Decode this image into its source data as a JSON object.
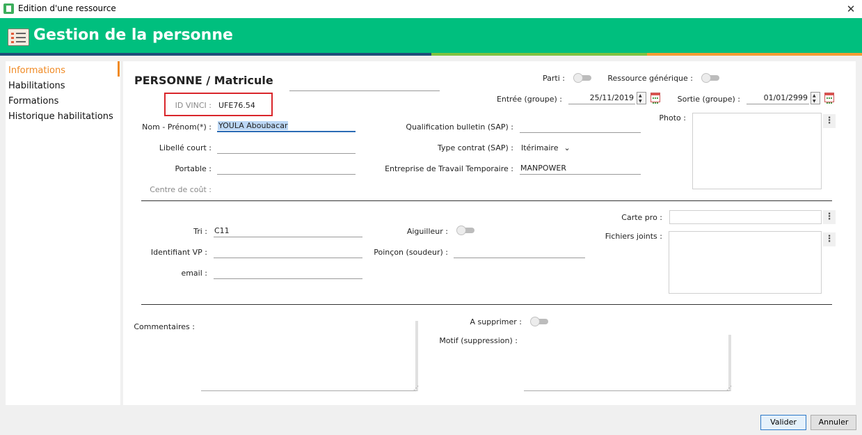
{
  "window": {
    "title": "Edition d'une ressource",
    "close_glyph": "✕"
  },
  "header": {
    "title": "Gestion de la personne",
    "icon": "list-icon",
    "stripe_colors": [
      "#1f4e79",
      "#7fc241",
      "#f39c34"
    ]
  },
  "nav": {
    "items": [
      {
        "label": "Informations",
        "active": true
      },
      {
        "label": "Habilitations",
        "active": false
      },
      {
        "label": "Formations",
        "active": false
      },
      {
        "label": "Historique habilitations",
        "active": false
      }
    ],
    "active_color": "#f08a24"
  },
  "form": {
    "section_title": "PERSONNE / Matricule",
    "id_vinci": {
      "label": "ID VINCI :",
      "value": "UFE76.54",
      "highlight_color": "#d9262b"
    },
    "nom_prenom": {
      "label": "Nom - Prénom(*) :",
      "value": "YOULA Aboubacar"
    },
    "libelle_court": {
      "label": "Libellé court :",
      "value": ""
    },
    "portable": {
      "label": "Portable :",
      "value": ""
    },
    "centre_cout": {
      "label": "Centre de coût :",
      "value": ""
    },
    "parti": {
      "label": "Parti :",
      "on": false
    },
    "ressource_generique": {
      "label": "Ressource générique :",
      "on": false
    },
    "entree": {
      "label": "Entrée (groupe) :",
      "value": "25/11/2019"
    },
    "sortie": {
      "label": "Sortie (groupe) :",
      "value": "01/01/2999"
    },
    "qualification": {
      "label": "Qualification bulletin (SAP) :",
      "value": ""
    },
    "type_contrat": {
      "label": "Type contrat (SAP) :",
      "value": "Itérimaire",
      "chevron": "⌄"
    },
    "ett": {
      "label": "Entreprise de Travail Temporaire :",
      "value": "MANPOWER"
    },
    "photo": {
      "label": "Photo :"
    },
    "tri": {
      "label": "Tri :",
      "value": "C11"
    },
    "identifiant_vp": {
      "label": "Identifiant VP :",
      "value": ""
    },
    "email": {
      "label": "email :",
      "value": ""
    },
    "aiguilleur": {
      "label": "Aiguilleur :",
      "on": false
    },
    "poincon": {
      "label": "Poinçon (soudeur) :",
      "value": ""
    },
    "carte_pro": {
      "label": "Carte pro :",
      "value": ""
    },
    "fichiers_joints": {
      "label": "Fichiers joints :"
    },
    "commentaires": {
      "label": "Commentaires :",
      "value": ""
    },
    "a_supprimer": {
      "label": "A supprimer :",
      "on": false
    },
    "motif": {
      "label": "Motif (suppression) :",
      "value": ""
    },
    "menu_glyph": "⋮"
  },
  "buttons": {
    "valider": "Valider",
    "annuler": "Annuler"
  }
}
